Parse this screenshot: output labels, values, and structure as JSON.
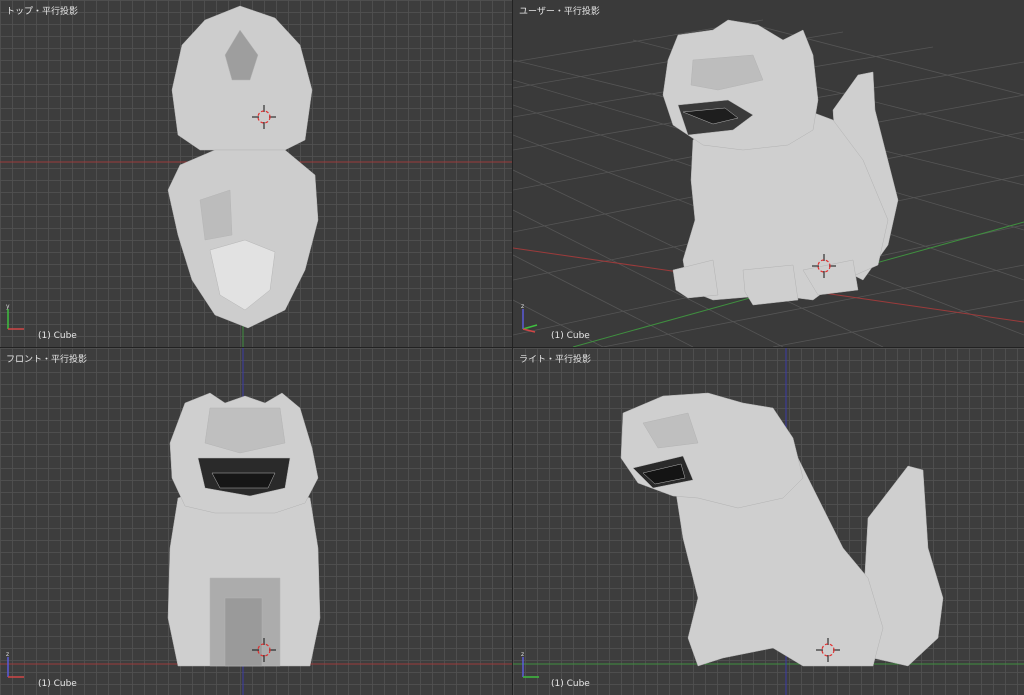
{
  "viewports": {
    "top": {
      "title": "トップ・平行投影",
      "object": "(1) Cube"
    },
    "user": {
      "title": "ユーザー・平行投影",
      "object": "(1) Cube"
    },
    "front": {
      "title": "フロント・平行投影",
      "object": "(1) Cube"
    },
    "right": {
      "title": "ライト・平行投影",
      "object": "(1) Cube"
    }
  },
  "colors": {
    "background": "#3d3d3d",
    "grid": "#505050",
    "x_axis": "#9c3b3b",
    "y_axis": "#3f8f3f",
    "z_axis": "#3a3aa8",
    "model": "#cfcfcf"
  }
}
